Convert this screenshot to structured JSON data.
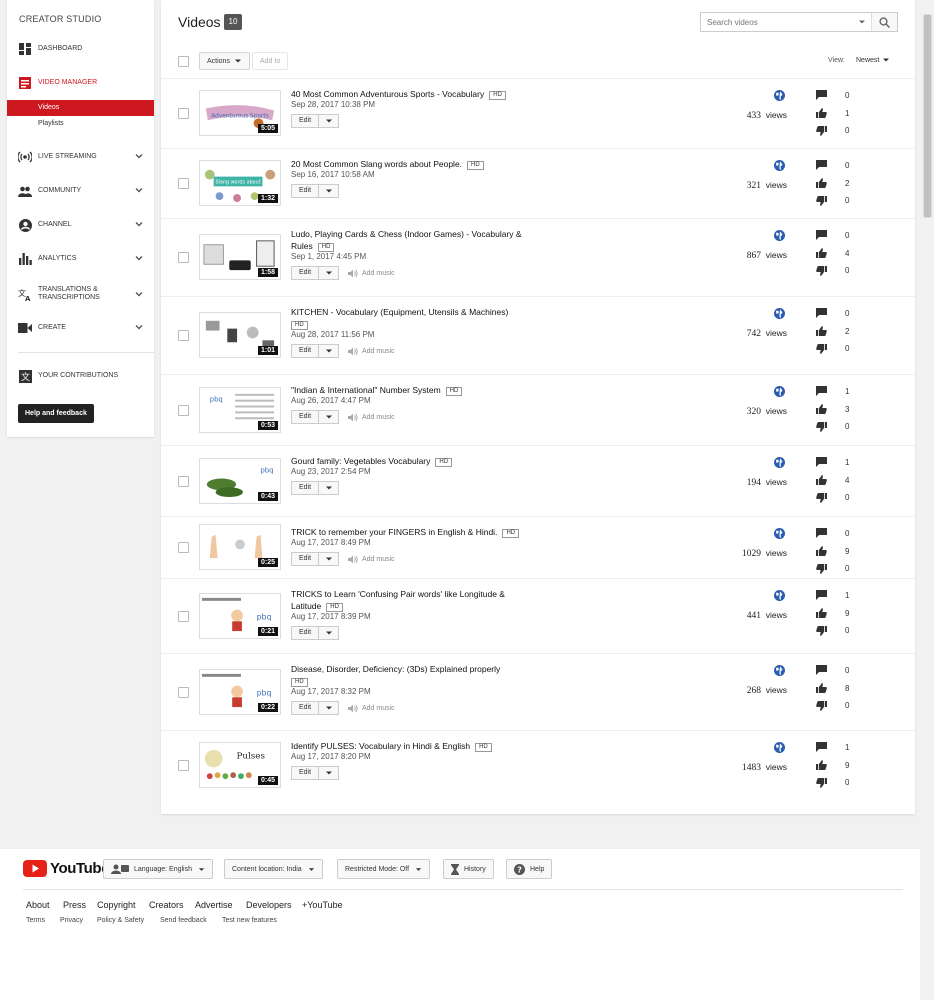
{
  "sidebar": {
    "title": "CREATOR STUDIO",
    "items": [
      {
        "label": "DASHBOARD",
        "icon": "dashboard-icon"
      },
      {
        "label": "VIDEO MANAGER",
        "icon": "video-manager-icon"
      },
      {
        "label": "LIVE STREAMING",
        "icon": "live-streaming-icon"
      },
      {
        "label": "COMMUNITY",
        "icon": "community-icon"
      },
      {
        "label": "CHANNEL",
        "icon": "channel-icon"
      },
      {
        "label": "ANALYTICS",
        "icon": "analytics-icon"
      },
      {
        "label": "TRANSLATIONS & TRANSCRIPTIONS",
        "icon": "translate-icon"
      },
      {
        "label": "CREATE",
        "icon": "create-icon"
      },
      {
        "label": "YOUR CONTRIBUTIONS",
        "icon": "contributions-icon"
      }
    ],
    "sub_items": [
      {
        "label": "Videos",
        "active": true
      },
      {
        "label": "Playlists",
        "active": false
      }
    ],
    "help_label": "Help and feedback",
    "accent_color": "#cc181e"
  },
  "header": {
    "title": "Videos",
    "count": "10",
    "search_placeholder": "Search videos"
  },
  "toolbar": {
    "actions_label": "Actions",
    "add_to_label": "Add to",
    "view_label": "View:",
    "sort_value": "Newest"
  },
  "labels": {
    "edit": "Edit",
    "add_music": "Add music",
    "views_suffix": "views",
    "hd": "HD"
  },
  "videos": [
    {
      "title": "40 Most Common Adventurous Sports - Vocabulary",
      "date": "Sep 28, 2017 10:38 PM",
      "duration": "5:05",
      "views": "433",
      "comments": "0",
      "likes": "1",
      "dislikes": "0",
      "add_music": false
    },
    {
      "title": "20 Most Common Slang words about People.",
      "date": "Sep 16, 2017 10:58 AM",
      "duration": "1:32",
      "views": "321",
      "comments": "0",
      "likes": "2",
      "dislikes": "0",
      "add_music": false
    },
    {
      "title": "Ludo, Playing Cards & Chess (Indoor Games) - Vocabulary & Rules",
      "date": "Sep 1, 2017 4:45 PM",
      "duration": "1:58",
      "views": "867",
      "comments": "0",
      "likes": "4",
      "dislikes": "0",
      "add_music": true
    },
    {
      "title": "KITCHEN - Vocabulary (Equipment, Utensils & Machines)",
      "date": "Aug 28, 2017 11:56 PM",
      "duration": "1:01",
      "views": "742",
      "comments": "0",
      "likes": "2",
      "dislikes": "0",
      "add_music": true
    },
    {
      "title": "\"Indian & International\" Number System",
      "date": "Aug 26, 2017 4:47 PM",
      "duration": "0:53",
      "views": "320",
      "comments": "1",
      "likes": "3",
      "dislikes": "0",
      "add_music": true
    },
    {
      "title": "Gourd family: Vegetables Vocabulary",
      "date": "Aug 23, 2017 2:54 PM",
      "duration": "0:43",
      "views": "194",
      "comments": "1",
      "likes": "4",
      "dislikes": "0",
      "add_music": false
    },
    {
      "title": "TRICK to remember your FINGERS in English & Hindi.",
      "date": "Aug 17, 2017 8:49 PM",
      "duration": "0:25",
      "views": "1029",
      "comments": "0",
      "likes": "9",
      "dislikes": "0",
      "add_music": true
    },
    {
      "title": "TRICKS to Learn 'Confusing Pair words' like Longitude & Latitude",
      "date": "Aug 17, 2017 8:39 PM",
      "duration": "0:21",
      "views": "441",
      "comments": "1",
      "likes": "9",
      "dislikes": "0",
      "add_music": false
    },
    {
      "title": "Disease, Disorder, Deficiency: (3Ds) Explained properly",
      "date": "Aug 17, 2017 8:32 PM",
      "duration": "0:22",
      "views": "268",
      "comments": "0",
      "likes": "8",
      "dislikes": "0",
      "add_music": true
    },
    {
      "title": "Identify PULSES: Vocabulary in Hindi & English",
      "date": "Aug 17, 2017 8:20 PM",
      "duration": "0:45",
      "views": "1483",
      "comments": "1",
      "likes": "9",
      "dislikes": "0",
      "add_music": false
    }
  ],
  "thumbs": {
    "t0": "Adventurous Sports",
    "t1": "Slang words about",
    "t5": "pbq",
    "t9": "Pulses"
  },
  "footer": {
    "logo_text": "YouTube",
    "language": "Language: English",
    "location": "Content location: India",
    "restricted": "Restricted Mode: Off",
    "history": "History",
    "help": "Help",
    "links": [
      "About",
      "Press",
      "Copyright",
      "Creators",
      "Advertise",
      "Developers",
      "+YouTube"
    ],
    "sub_links": [
      "Terms",
      "Privacy",
      "Policy & Safety",
      "Send feedback",
      "Test new features"
    ]
  }
}
